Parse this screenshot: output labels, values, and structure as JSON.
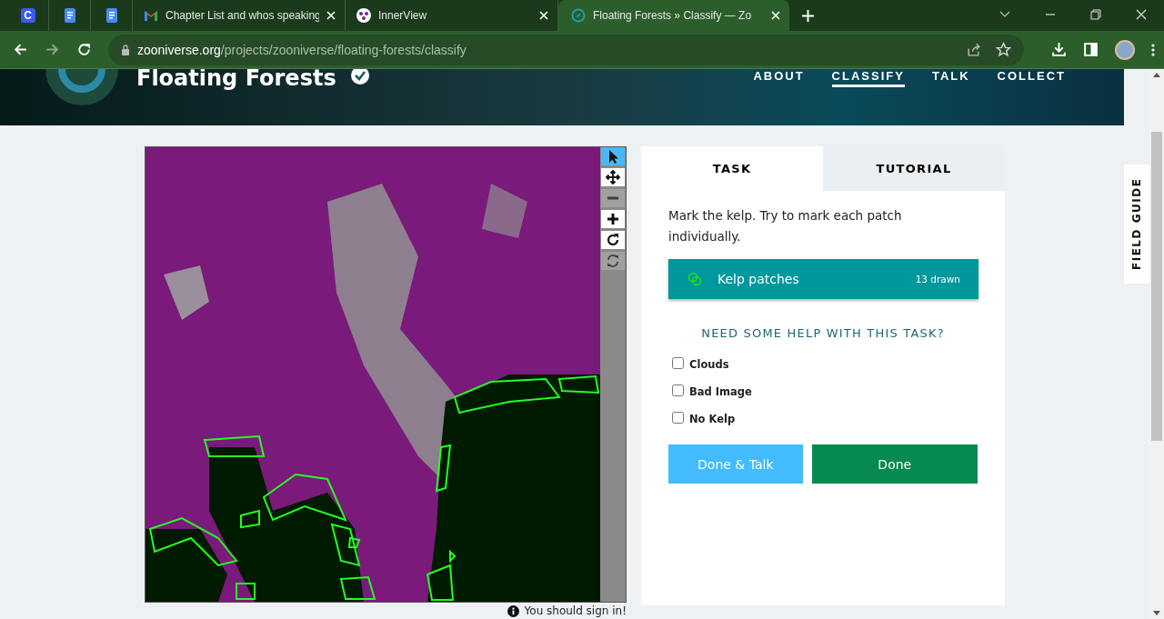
{
  "browser": {
    "tabs": [
      {
        "kind": "letter",
        "label": "C",
        "selected": false
      },
      {
        "kind": "doc",
        "selected": false
      },
      {
        "kind": "doc",
        "selected": false
      },
      {
        "kind": "mail",
        "title": "Chapter List and whos speaking",
        "selected": false
      },
      {
        "kind": "dots",
        "title": "InnerView",
        "selected": false
      },
      {
        "kind": "compass",
        "title": "Floating Forests » Classify — Zo",
        "selected": true
      }
    ],
    "url": {
      "host": "zooniverse.org",
      "path": "/projects/zooniverse/floating-forests/classify"
    }
  },
  "header": {
    "title": "Floating Forests",
    "nav": [
      {
        "label": "ABOUT",
        "selected": false
      },
      {
        "label": "CLASSIFY",
        "selected": true
      },
      {
        "label": "TALK",
        "selected": false
      },
      {
        "label": "COLLECT",
        "selected": false
      }
    ]
  },
  "image_tools": [
    {
      "kind": "pointer",
      "selected": true,
      "disabled": false
    },
    {
      "kind": "move",
      "selected": false,
      "disabled": false
    },
    {
      "kind": "zoom-out",
      "selected": false,
      "disabled": true
    },
    {
      "kind": "zoom-in",
      "selected": false,
      "disabled": false
    },
    {
      "kind": "rotate",
      "selected": false,
      "disabled": false
    },
    {
      "kind": "reset",
      "selected": false,
      "disabled": true
    }
  ],
  "sign_in_notice": "You should sign in!",
  "panel": {
    "tabs": [
      {
        "label": "TASK",
        "selected": true
      },
      {
        "label": "TUTORIAL",
        "selected": false
      }
    ],
    "instruction": "Mark the kelp. Try to mark each patch individually.",
    "tool": {
      "label": "Kelp patches",
      "count": "13 drawn",
      "selected": true
    },
    "help_heading": "NEED SOME HELP WITH THIS TASK?",
    "options": [
      {
        "label": "Clouds",
        "checked": false
      },
      {
        "label": "Bad Image",
        "checked": false
      },
      {
        "label": "No Kelp",
        "checked": false
      }
    ],
    "buttons": [
      {
        "kind": "talk",
        "label": "Done & Talk"
      },
      {
        "kind": "done",
        "label": "Done"
      }
    ]
  },
  "field_guide": "FIELD GUIDE"
}
